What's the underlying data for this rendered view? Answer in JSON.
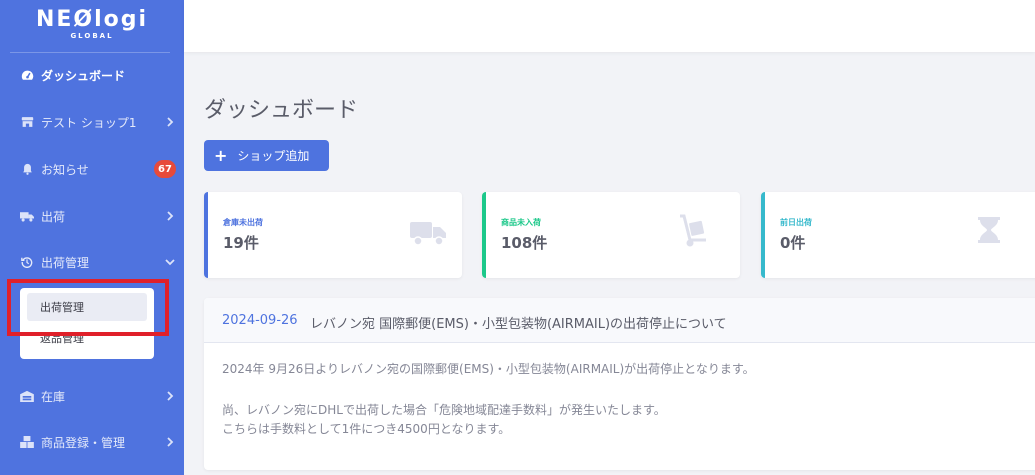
{
  "brand": {
    "name": "NEØlogi",
    "sub": "GLOBAL"
  },
  "sidebar": {
    "items": [
      {
        "label": "ダッシュボード",
        "icon": "tachometer-icon"
      },
      {
        "label": "テスト ショップ1",
        "icon": "store-icon"
      },
      {
        "label": "お知らせ",
        "icon": "bell-icon",
        "badge": "67"
      },
      {
        "label": "出荷",
        "icon": "truck-icon"
      },
      {
        "label": "出荷管理",
        "icon": "history-icon"
      },
      {
        "label": "在庫",
        "icon": "warehouse-icon"
      },
      {
        "label": "商品登録・管理",
        "icon": "boxes-icon"
      }
    ],
    "submenu": [
      "出荷管理",
      "返品管理"
    ]
  },
  "main": {
    "title": "ダッシュボード",
    "add_button": "ショップ追加",
    "cards": [
      {
        "label": "倉庫未出荷",
        "value": "19件",
        "color": "#4e73df",
        "icon": "truck-icon"
      },
      {
        "label": "商品未入荷",
        "value": "108件",
        "color": "#1cc88a",
        "icon": "dolly-icon"
      },
      {
        "label": "前日出荷",
        "value": "0件",
        "color": "#36b9cc",
        "icon": "hourglass-icon"
      }
    ],
    "notice": {
      "date": "2024-09-26",
      "title": "レバノン宛 国際郵便(EMS)・小型包装物(AIRMAIL)の出荷停止について",
      "lines": [
        "2024年 9月26日よりレバノン宛の国際郵便(EMS)・小型包装物(AIRMAIL)が出荷停止となります。",
        "尚、レバノン宛にDHLで出荷した場合「危険地域配達手数料」が発生いたします。",
        "こちらは手数料として1件につき4500円となります。"
      ]
    }
  },
  "colors": {
    "sidebar": "#4f73df",
    "primary": "#4e73df",
    "success": "#1cc88a",
    "info": "#36b9cc",
    "danger": "#e74a3b"
  }
}
